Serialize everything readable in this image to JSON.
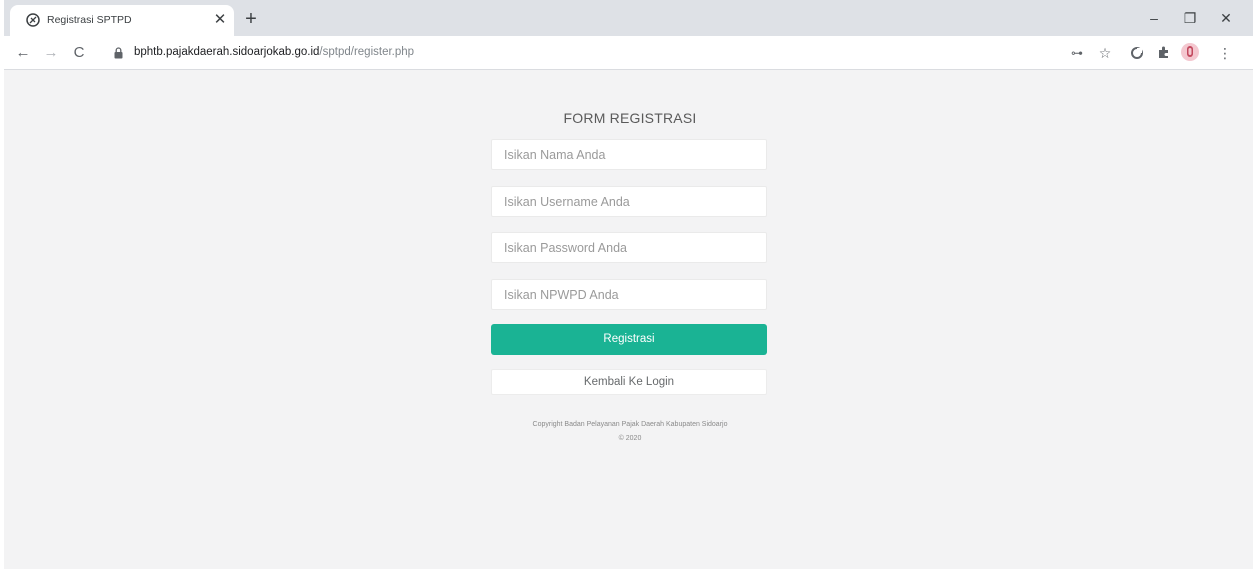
{
  "browser": {
    "tab": {
      "title": "Registrasi SPTPD",
      "close_glyph": "✕",
      "favicon": "globe-icon"
    },
    "new_tab_glyph": "+",
    "window_controls": {
      "minimize": "–",
      "restore": "❐",
      "close": "✕"
    },
    "nav": {
      "back": "←",
      "forward": "→",
      "reload": "C"
    },
    "url": {
      "host": "bphtb.pajakdaerah.sidoarjokab.go.id",
      "path": "/sptpd/register.php"
    },
    "toolbar_icons": {
      "key": "⊶",
      "star": "☆",
      "menu": "⋮"
    }
  },
  "form": {
    "title": "FORM REGISTRASI",
    "name_placeholder": "Isikan Nama Anda",
    "username_placeholder": "Isikan Username Anda",
    "password_placeholder": "Isikan Password Anda",
    "npwpd_placeholder": "Isikan NPWPD Anda",
    "register_label": "Registrasi",
    "back_label": "Kembali Ke Login",
    "copyright_line1": "Copyright Badan Pelayanan Pajak Daerah Kabupaten Sidoarjo",
    "copyright_line2": "© 2020"
  },
  "colors": {
    "accent": "#1ab394",
    "page_bg": "#f3f3f4",
    "tabstrip_bg": "#dee1e6"
  }
}
